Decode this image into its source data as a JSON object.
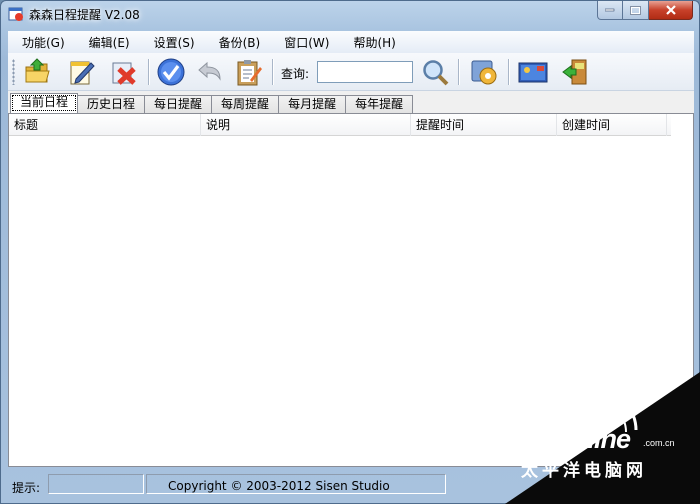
{
  "window": {
    "title": "森森日程提醒 V2.08"
  },
  "menu": [
    {
      "label": "功能(G)"
    },
    {
      "label": "编辑(E)"
    },
    {
      "label": "设置(S)"
    },
    {
      "label": "备份(B)"
    },
    {
      "label": "窗口(W)"
    },
    {
      "label": "帮助(H)"
    }
  ],
  "toolbar": {
    "buttons": [
      {
        "icon": "open-folder-icon"
      },
      {
        "icon": "edit-note-icon"
      },
      {
        "icon": "delete-icon"
      },
      {
        "icon": "check-icon"
      },
      {
        "icon": "undo-icon"
      },
      {
        "icon": "clipboard-icon"
      },
      {
        "icon": "search-icon"
      },
      {
        "icon": "settings-icon"
      },
      {
        "icon": "screen-icon"
      },
      {
        "icon": "exit-icon"
      }
    ],
    "query_label": "查询:",
    "query_value": ""
  },
  "tabs": [
    {
      "label": "当前日程",
      "active": true
    },
    {
      "label": "历史日程"
    },
    {
      "label": "每日提醒"
    },
    {
      "label": "每周提醒"
    },
    {
      "label": "每月提醒"
    },
    {
      "label": "每年提醒"
    }
  ],
  "list": {
    "columns": [
      "标题",
      "说明",
      "提醒时间",
      "创建时间"
    ],
    "rows": []
  },
  "status": {
    "label": "提示:",
    "copyright": "Copyright © 2003-2012 Sisen Studio"
  },
  "watermark": {
    "brand": "PConline",
    "domain": ".com.cn",
    "cn_name": "太平洋电脑网"
  }
}
